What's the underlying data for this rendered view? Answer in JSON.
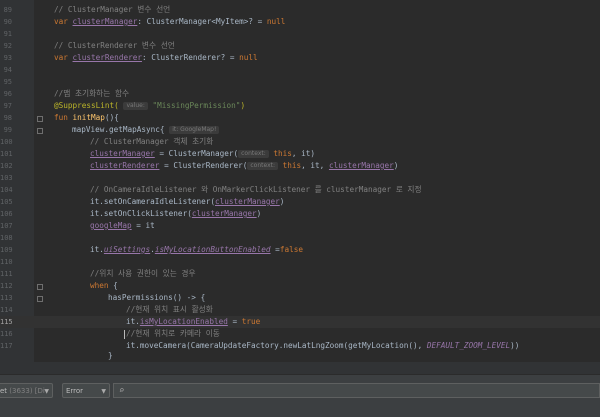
{
  "editor": {
    "lines": [
      {
        "n": "89"
      },
      {
        "n": "90"
      },
      {
        "n": "91"
      },
      {
        "n": "92"
      },
      {
        "n": "93"
      },
      {
        "n": "94"
      },
      {
        "n": "95"
      },
      {
        "n": "96"
      },
      {
        "n": "97"
      },
      {
        "n": "98"
      },
      {
        "n": "99"
      },
      {
        "n": "100"
      },
      {
        "n": "101"
      },
      {
        "n": "102"
      },
      {
        "n": "103"
      },
      {
        "n": "104"
      },
      {
        "n": "105"
      },
      {
        "n": "106"
      },
      {
        "n": "107"
      },
      {
        "n": "108"
      },
      {
        "n": "109"
      },
      {
        "n": "110"
      },
      {
        "n": "111"
      },
      {
        "n": "112"
      },
      {
        "n": "113"
      },
      {
        "n": "114"
      },
      {
        "n": "115"
      },
      {
        "n": "116"
      },
      {
        "n": "117"
      }
    ],
    "current_line": "115",
    "t": {
      "c89": "// ClusterManager 변수 선언",
      "var": "var",
      "clusterManager": "clusterManager",
      "t90b": ": ClusterManager<MyItem>? = ",
      "null": "null",
      "c92": "// ClusterRenderer 변수 선언",
      "clusterRenderer": "clusterRenderer",
      "t93b": ": ClusterRenderer? = ",
      "c96": "//맵 초기화하는 함수",
      "suppress": "@SuppressLint(",
      "hint_value": "value:",
      "missing": "\"MissingPermission\"",
      "close_paren": ")",
      "fun": "fun",
      "initMap": "initMap",
      "t98b": "(){",
      "t99a": "mapView.getMapAsync{",
      "hint_it": "it: GoogleMap!",
      "c100": "// ClusterManager 객체 초기화",
      "t101b": " = ClusterManager(",
      "hint_context": "context:",
      "this": "this",
      "t101c": ", it)",
      "t102b": " = ClusterRenderer(",
      "t102c": ", it, ",
      "c104": "// OnCameraIdleListener 와 OnMarkerClickListener 를 clusterManager 로 지정",
      "t105a": "it.setOnCameraIdleListener(",
      "t106a": "it.setOnClickListener(",
      "googleMap": "googleMap",
      "t107b": " = it",
      "it_dot": "it.",
      "uiSettings": "uiSettings",
      "dot": ".",
      "isMyLoc": "isMyLocationButtonEnabled",
      "t109b": " =",
      "false": "false",
      "c111": "//위치 사용 권한이 있는 경우",
      "when": "when",
      "t112b": " {",
      "t113": "hasPermissions() -> {",
      "c114": "//현재 위치 표시 활성화",
      "isMyLocEnabled": "isMyLocationEnabled",
      "t115b": " = ",
      "true": "true",
      "c116": "//현재 위치로 카메라 이동",
      "t117a": "it.moveCamera(CameraUpdateFactory.newLatLngZoom(getMyLocation(), ",
      "default_zoom": "DEFAULT_ZOOM_LEVEL",
      "t117b": "))",
      "brace": "}"
    }
  },
  "bottom_bar": {
    "device_prefix": "et",
    "device_suffix": "(3633) [Di",
    "log_level": "Error",
    "search_value": ""
  },
  "colors": {
    "background": "#2b2b2b",
    "keyword": "#cc7832",
    "comment": "#808080",
    "property": "#9876aa",
    "function": "#ffc66d",
    "string": "#6a8759",
    "annotation": "#bbb529"
  }
}
